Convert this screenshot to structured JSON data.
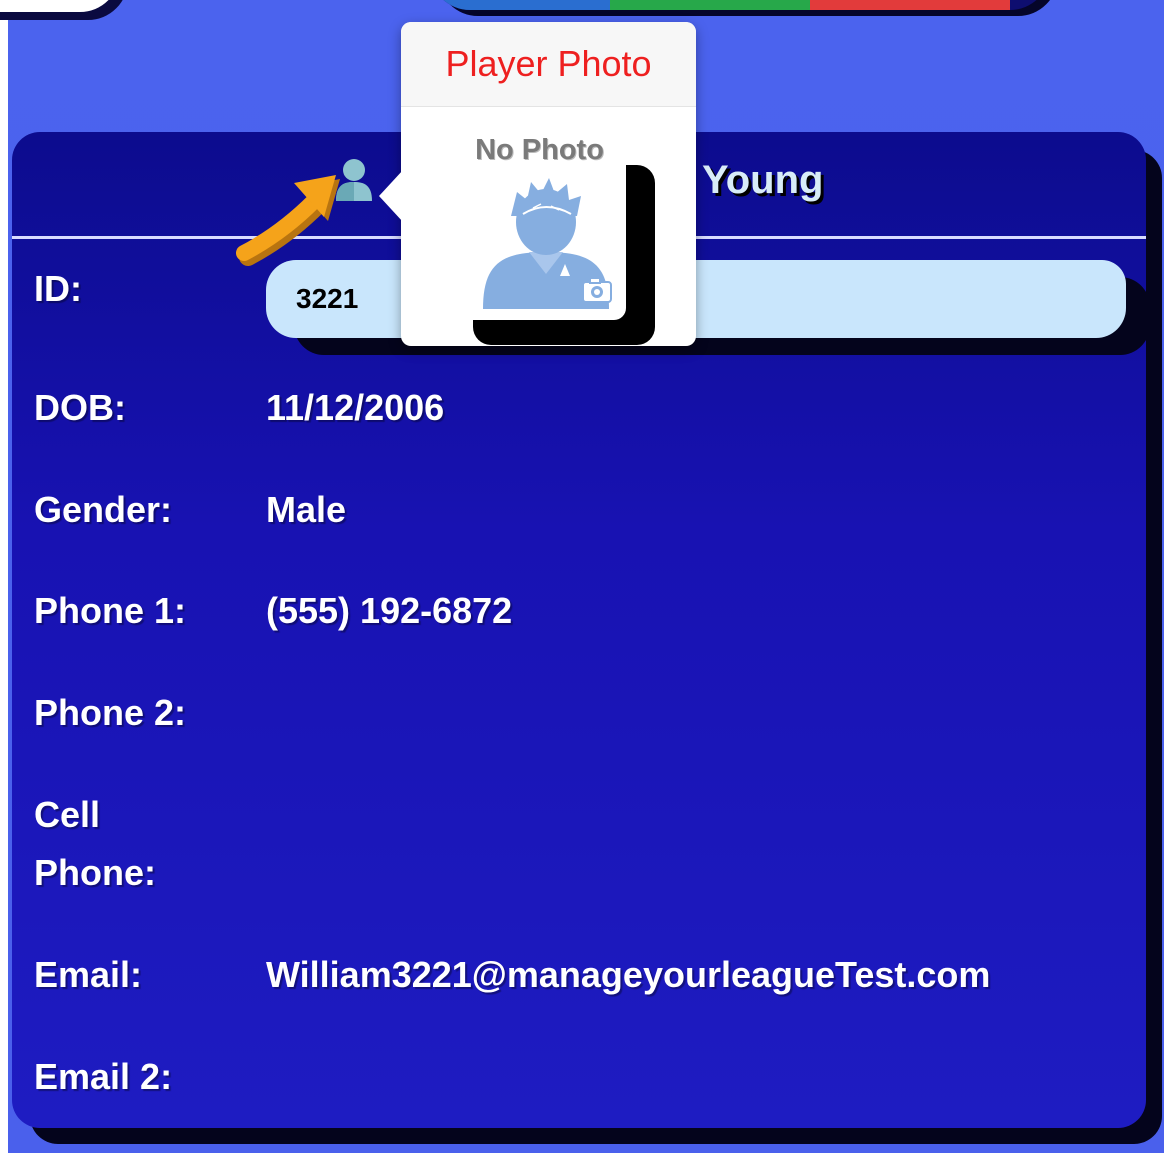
{
  "popover": {
    "title": "Player Photo",
    "no_photo_label": "No Photo"
  },
  "player": {
    "name_suffix": "Young"
  },
  "fields": {
    "id_label": "ID:",
    "id_value": "3221",
    "dob_label": "DOB:",
    "dob_value": "11/12/2006",
    "gender_label": "Gender:",
    "gender_value": "Male",
    "phone1_label": "Phone 1:",
    "phone1_value": "(555) 192-6872",
    "phone2_label": "Phone 2:",
    "phone2_value": "",
    "cell_label_line1": "Cell",
    "cell_label_line2": "Phone:",
    "cell_value": "",
    "email_label": "Email:",
    "email_value": "William3221@manageyourleagueTest.com",
    "email2_label": "Email 2:",
    "email2_value": ""
  },
  "colors": {
    "page_bg": "#4b63ee",
    "card_bg": "#1a14b8",
    "popover_title": "#ee2020",
    "id_field_bg": "#c9e6fc",
    "arrow": "#f5a31a"
  },
  "icons": {
    "header_icon": "person-icon",
    "arrow": "arrow-pointer-icon",
    "avatar": "avatar-placeholder-icon",
    "camera": "camera-icon"
  }
}
